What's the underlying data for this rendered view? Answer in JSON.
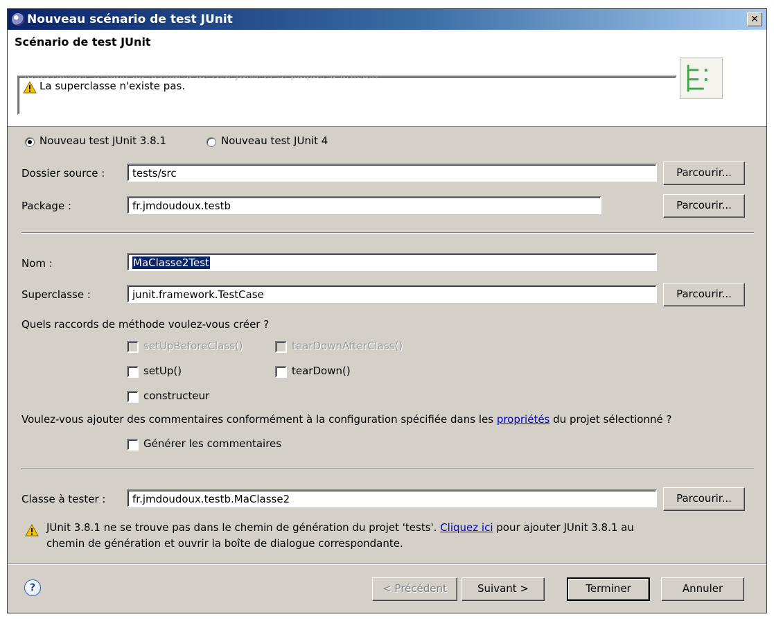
{
  "window": {
    "title": "Nouveau scénario de test JUnit",
    "close_label": "✕"
  },
  "banner": {
    "heading": "Scénario de test JUnit",
    "cut_text": "Sélectionnez le nom du scénario de test JUnit et le paquet à utiliser.",
    "message": "La superclasse n'existe pas."
  },
  "options": {
    "radio_junit3": "Nouveau test JUnit 3.8.1",
    "radio_junit4": "Nouveau test JUnit 4"
  },
  "fields": {
    "source_folder_label": "Dossier source :",
    "source_folder_value": "tests/src",
    "package_label": "Package :",
    "package_value": "fr.jmdoudoux.testb",
    "name_label": "Nom :",
    "name_value": "MaClasse2Test",
    "superclass_label": "Superclasse :",
    "superclass_value": "junit.framework.TestCase",
    "class_to_test_label": "Classe à tester :",
    "class_to_test_value": "fr.jmdoudoux.testb.MaClasse2",
    "browse_label": "Parcourir..."
  },
  "stubs": {
    "question": "Quels raccords de méthode voulez-vous créer ?",
    "setUpBeforeClass": "setUpBeforeClass()",
    "tearDownAfterClass": "tearDownAfterClass()",
    "setUp": "setUp()",
    "tearDown": "tearDown()",
    "constructor": "constructeur"
  },
  "comments": {
    "question_before": "Voulez-vous ajouter des commentaires conformément à la configuration spécifiée dans les ",
    "question_link": "propriétés",
    "question_after": " du projet sélectionné ?",
    "generate": "Générer les commentaires"
  },
  "warning": {
    "text_before": "JUnit 3.8.1 ne se trouve pas dans le chemin de génération du projet 'tests'. ",
    "link": "Cliquez ici",
    "text_after": " pour ajouter JUnit 3.8.1 au",
    "line2": "chemin de génération et ouvrir la boîte de dialogue correspondante."
  },
  "footer": {
    "help": "?",
    "previous": "< Précédent",
    "next": "Suivant >",
    "finish": "Terminer",
    "cancel": "Annuler"
  },
  "colors": {
    "title_gradient_start": "#0a246a",
    "dialog_bg": "#d4d0c8",
    "selection": "#0a246a",
    "link": "#0000cc"
  }
}
